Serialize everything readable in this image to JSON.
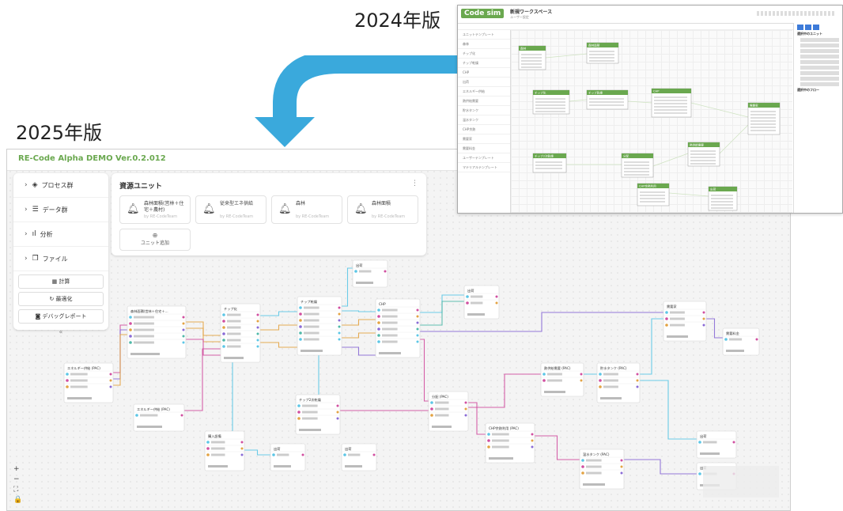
{
  "labels": {
    "y2024": "2024年版",
    "y2025": "2025年版"
  },
  "app2025": {
    "title": "RE-Code Alpha DEMO Ver.0.2.012",
    "sidebar": {
      "sections": [
        {
          "label": "プロセス群",
          "icon": "layers-icon"
        },
        {
          "label": "データ群",
          "icon": "database-icon"
        },
        {
          "label": "分析",
          "icon": "bar-chart-icon"
        },
        {
          "label": "ファイル",
          "icon": "files-icon"
        }
      ],
      "buttons": [
        {
          "label": "計算",
          "icon": "calculator-icon"
        },
        {
          "label": "最適化",
          "icon": "refresh-icon"
        },
        {
          "label": "デバッグレポート",
          "icon": "camera-icon"
        }
      ],
      "collapse": "«"
    },
    "resources": {
      "title": "資源ユニット",
      "menu_icon": "⋮",
      "units": [
        {
          "name": "森林面積(営林＋住宅＋農村)",
          "by": "by RE-CodeTeam"
        },
        {
          "name": "従来型エネ供給",
          "by": "by RE-CodeTeam"
        },
        {
          "name": "森林",
          "by": "by RE-CodeTeam"
        },
        {
          "name": "森林面積",
          "by": "by RE-CodeTeam"
        }
      ],
      "add_label": "ユニット追加",
      "add_icon": "⊕"
    },
    "flow_nodes": [
      {
        "title": "森林面積(営林＋住宅＋…"
      },
      {
        "title": "チップ化"
      },
      {
        "title": "チップ乾燥"
      },
      {
        "title": "CHP"
      },
      {
        "title": "出荷"
      },
      {
        "title": "出荷"
      },
      {
        "title": "エネルギー供給 (PAC)"
      },
      {
        "title": "エネルギー供給 (PAC)"
      },
      {
        "title": "チップ2次乾燥"
      },
      {
        "title": "購入設備"
      },
      {
        "title": "出荷"
      },
      {
        "title": "出荷"
      },
      {
        "title": "分配 (PAC)"
      },
      {
        "title": "熱供給需要 (PAC)"
      },
      {
        "title": "貯水タンク (PAC)"
      },
      {
        "title": "CHP余熱利用 (PAC)"
      },
      {
        "title": "温水タンク (PAC)"
      },
      {
        "title": "需要家"
      },
      {
        "title": "需要料金"
      },
      {
        "title": "出荷"
      },
      {
        "title": "出荷"
      }
    ],
    "zoom_controls": [
      "+",
      "−",
      "⛶",
      "🔒"
    ]
  },
  "app2024": {
    "logo": "Code sim",
    "workspace": "新規ワークスペース",
    "sub": "ユーザー設定",
    "sidebar_items": [
      "ユニットテンプレート",
      "森林",
      "チップ化",
      "チップ乾燥",
      "CHP",
      "出荷",
      "エネルギー供給",
      "熱供給需要",
      "貯水タンク",
      "温水タンク",
      "CHP余熱",
      "需要家",
      "需要料金",
      "ユーザーテンプレート",
      "マテリアルテンプレート"
    ],
    "node_titles": [
      "森林",
      "森林面積",
      "チップ化",
      "チップ乾燥",
      "CHP",
      "需要家",
      "チップ2次乾燥",
      "分配",
      "熱供給需要",
      "CHP余熱利用",
      "出荷"
    ],
    "right_title": "選択中のユニット",
    "right_title2": "選択中のフロー"
  },
  "colors": {
    "green": "#6aa84f",
    "arrow": "#3aa9dc",
    "pink": "#d14fa0",
    "orange": "#e3a343",
    "cyan": "#5cc6e6",
    "purple": "#8a6bd6",
    "teal": "#4fb8a8"
  }
}
